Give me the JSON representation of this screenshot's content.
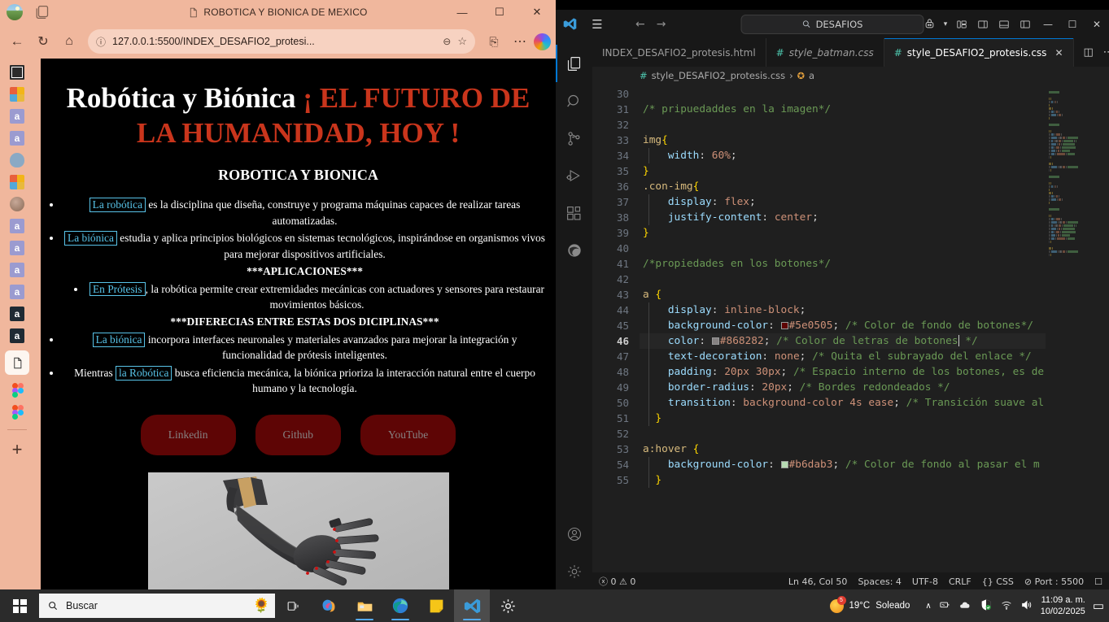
{
  "browser": {
    "window_title": "ROBOTICA Y BIONICA DE MEXICO",
    "url": "127.0.0.1:5500/INDEX_DESAFIO2_protesi...",
    "minimize": "—",
    "maximize": "☐",
    "close": "✕",
    "back_icon": "←",
    "refresh_icon": "↻",
    "home_icon": "⌂",
    "info_icon": "ⓘ",
    "zoom_icon": "⊖",
    "favorite_icon": "☆",
    "collections_icon": "⎘",
    "more_icon": "⋯",
    "sidebar_plus": "+"
  },
  "page": {
    "title_white": "Robótica y Biónica",
    "title_red": "¡ EL FUTURO DE LA HUMANIDAD, HOY !",
    "subtitle": "ROBOTICA Y BIONICA",
    "items": [
      {
        "tag": "La robótica",
        "text": " es la disciplina que diseña, construye y programa máquinas capaces de realizar tareas automatizadas."
      },
      {
        "tag": "La biónica",
        "text": " estudia y aplica principios biológicos en sistemas tecnológicos, inspirándose en organismos vivos para mejorar dispositivos artificiales."
      }
    ],
    "section_aplicaciones": "***APLICACIONES***",
    "item_protesis_tag": "En Prótesis",
    "item_protesis_text": ", la robótica permite crear extremidades mecánicas con actuadores y sensores para restaurar movimientos básicos.",
    "section_diferencias": "***DIFERECIAS ENTRE ESTAS DOS DICIPLINAS***",
    "items2": [
      {
        "pre": "",
        "tag": "La biónica",
        "text": " incorpora interfaces neuronales y materiales avanzados para mejorar la integración y funcionalidad de prótesis inteligentes."
      },
      {
        "pre": "Mientras ",
        "tag": "la Robótica",
        "text": " busca eficiencia mecánica, la biónica prioriza la interacción natural entre el cuerpo humano y la tecnología."
      }
    ],
    "buttons": [
      "Linkedin",
      "Github",
      "YouTube"
    ],
    "colors": {
      "button_bg": "#5e0505",
      "button_text": "#868282",
      "tag_color": "#58c3e8",
      "heading_red": "#c9351c",
      "page_bg": "#000000"
    }
  },
  "vscode": {
    "search_placeholder": "DESAFIOS",
    "search_icon": "⌕",
    "hamburger_icon": "☰",
    "back_icon": "←",
    "forward_icon": "→",
    "accounts_icon": "☉",
    "layout_icons": [
      "⌸",
      "◫",
      "▥",
      "◫"
    ],
    "minimize": "—",
    "maximize": "☐",
    "close": "✕",
    "tabs": [
      {
        "label": "INDEX_DESAFIO2_protesis.html",
        "hash": "",
        "active": false,
        "italic": false
      },
      {
        "label": "style_batman.css",
        "hash": "#",
        "active": false,
        "italic": true
      },
      {
        "label": "style_DESAFIO2_protesis.css",
        "hash": "#",
        "active": true,
        "italic": false
      }
    ],
    "tab_close": "✕",
    "split_icon": "◫",
    "more_icon": "⋯",
    "breadcrumb": {
      "hash": "#",
      "file": "style_DESAFIO2_protesis.css",
      "sep": "›",
      "symbol": "a"
    },
    "line_start": 30,
    "lines": [
      {
        "n": 30,
        "tokens": []
      },
      {
        "n": 31,
        "tokens": [
          {
            "t": "comment",
            "v": "/* pripuedaddes en la imagen*/"
          }
        ]
      },
      {
        "n": 32,
        "tokens": []
      },
      {
        "n": 33,
        "tokens": [
          {
            "t": "selector",
            "v": "img"
          },
          {
            "t": "brace",
            "v": "{"
          }
        ]
      },
      {
        "n": 34,
        "tokens": [
          {
            "t": "plain",
            "v": "    "
          },
          {
            "t": "prop",
            "v": "width"
          },
          {
            "t": "punct",
            "v": ": "
          },
          {
            "t": "val",
            "v": "60%"
          },
          {
            "t": "punct",
            "v": ";"
          }
        ]
      },
      {
        "n": 35,
        "tokens": [
          {
            "t": "brace",
            "v": "}"
          }
        ]
      },
      {
        "n": 36,
        "tokens": [
          {
            "t": "selector",
            "v": ".con-img"
          },
          {
            "t": "brace",
            "v": "{"
          }
        ]
      },
      {
        "n": 37,
        "tokens": [
          {
            "t": "plain",
            "v": "    "
          },
          {
            "t": "prop",
            "v": "display"
          },
          {
            "t": "punct",
            "v": ": "
          },
          {
            "t": "val",
            "v": "flex"
          },
          {
            "t": "punct",
            "v": ";"
          }
        ]
      },
      {
        "n": 38,
        "tokens": [
          {
            "t": "plain",
            "v": "    "
          },
          {
            "t": "prop",
            "v": "justify-content"
          },
          {
            "t": "punct",
            "v": ": "
          },
          {
            "t": "val",
            "v": "center"
          },
          {
            "t": "punct",
            "v": ";"
          }
        ]
      },
      {
        "n": 39,
        "tokens": [
          {
            "t": "brace",
            "v": "}"
          }
        ]
      },
      {
        "n": 40,
        "tokens": []
      },
      {
        "n": 41,
        "tokens": [
          {
            "t": "comment",
            "v": "/*propiedades en los botones*/"
          }
        ]
      },
      {
        "n": 42,
        "tokens": []
      },
      {
        "n": 43,
        "tokens": [
          {
            "t": "selector",
            "v": "a "
          },
          {
            "t": "brace",
            "v": "{"
          }
        ]
      },
      {
        "n": 44,
        "tokens": [
          {
            "t": "plain",
            "v": "    "
          },
          {
            "t": "prop",
            "v": "display"
          },
          {
            "t": "punct",
            "v": ": "
          },
          {
            "t": "val",
            "v": "inline-block"
          },
          {
            "t": "punct",
            "v": ";"
          }
        ]
      },
      {
        "n": 45,
        "tokens": [
          {
            "t": "plain",
            "v": "    "
          },
          {
            "t": "prop",
            "v": "background-color"
          },
          {
            "t": "punct",
            "v": ": "
          },
          {
            "t": "swatch",
            "v": "#5e0505"
          },
          {
            "t": "val",
            "v": "#5e0505"
          },
          {
            "t": "punct",
            "v": "; "
          },
          {
            "t": "comment",
            "v": "/* Color de fondo de botones*/"
          }
        ]
      },
      {
        "n": 46,
        "tokens": [
          {
            "t": "plain",
            "v": "    "
          },
          {
            "t": "prop",
            "v": "color"
          },
          {
            "t": "punct",
            "v": ": "
          },
          {
            "t": "swatch",
            "v": "#868282"
          },
          {
            "t": "val",
            "v": "#868282"
          },
          {
            "t": "punct",
            "v": "; "
          },
          {
            "t": "comment",
            "v": "/* Color de letras de botones"
          },
          {
            "t": "caret",
            "v": ""
          },
          {
            "t": "comment",
            "v": " */"
          }
        ]
      },
      {
        "n": 47,
        "tokens": [
          {
            "t": "plain",
            "v": "    "
          },
          {
            "t": "prop",
            "v": "text-decoration"
          },
          {
            "t": "punct",
            "v": ": "
          },
          {
            "t": "val",
            "v": "none"
          },
          {
            "t": "punct",
            "v": "; "
          },
          {
            "t": "comment",
            "v": "/* Quita el subrayado del enlace */"
          }
        ]
      },
      {
        "n": 48,
        "tokens": [
          {
            "t": "plain",
            "v": "    "
          },
          {
            "t": "prop",
            "v": "padding"
          },
          {
            "t": "punct",
            "v": ": "
          },
          {
            "t": "val",
            "v": "20px 30px"
          },
          {
            "t": "punct",
            "v": "; "
          },
          {
            "t": "comment",
            "v": "/* Espacio interno de los botones, es de"
          }
        ]
      },
      {
        "n": 49,
        "tokens": [
          {
            "t": "plain",
            "v": "    "
          },
          {
            "t": "prop",
            "v": "border-radius"
          },
          {
            "t": "punct",
            "v": ": "
          },
          {
            "t": "val",
            "v": "20px"
          },
          {
            "t": "punct",
            "v": "; "
          },
          {
            "t": "comment",
            "v": "/* Bordes redondeados */"
          }
        ]
      },
      {
        "n": 50,
        "tokens": [
          {
            "t": "plain",
            "v": "    "
          },
          {
            "t": "prop",
            "v": "transition"
          },
          {
            "t": "punct",
            "v": ": "
          },
          {
            "t": "val",
            "v": "background-color 4s ease"
          },
          {
            "t": "punct",
            "v": "; "
          },
          {
            "t": "comment",
            "v": "/* Transición suave al"
          }
        ]
      },
      {
        "n": 51,
        "tokens": [
          {
            "t": "plain",
            "v": "  "
          },
          {
            "t": "brace",
            "v": "}"
          }
        ]
      },
      {
        "n": 52,
        "tokens": []
      },
      {
        "n": 53,
        "tokens": [
          {
            "t": "selector",
            "v": "a:hover "
          },
          {
            "t": "brace",
            "v": "{"
          }
        ]
      },
      {
        "n": 54,
        "tokens": [
          {
            "t": "plain",
            "v": "    "
          },
          {
            "t": "prop",
            "v": "background-color"
          },
          {
            "t": "punct",
            "v": ": "
          },
          {
            "t": "swatch",
            "v": "#b6dab3"
          },
          {
            "t": "val",
            "v": "#b6dab3"
          },
          {
            "t": "punct",
            "v": "; "
          },
          {
            "t": "comment",
            "v": "/* Color de fondo al pasar el m"
          }
        ]
      },
      {
        "n": 55,
        "tokens": [
          {
            "t": "plain",
            "v": "  "
          },
          {
            "t": "brace",
            "v": "}"
          }
        ]
      }
    ],
    "cursor_line": 46,
    "status": {
      "errors_icon": "ⓧ",
      "errors": "0",
      "warnings_icon": "⚠",
      "warnings": "0",
      "position": "Ln 46, Col 50",
      "spaces": "Spaces: 4",
      "encoding": "UTF-8",
      "eol": "CRLF",
      "language_icon": "{}",
      "language": "CSS",
      "port": "Port : 5500",
      "port_icon": "⊘",
      "bell_icon": "☐"
    },
    "activity_icons": [
      "explorer-icon",
      "search-icon",
      "source-control-icon",
      "run-debug-icon",
      "extensions-icon",
      "edge-tools-icon"
    ],
    "bottom_icons": [
      "accounts-icon",
      "settings-gear-icon"
    ]
  },
  "taskbar": {
    "search_text": "Buscar",
    "search_icon": "⌕",
    "apps": [
      "task-view",
      "copilot",
      "file-explorer",
      "edge",
      "sticky-notes",
      "vscode",
      "settings"
    ],
    "weather_temp": "19°C",
    "weather_desc": "Soleado",
    "weather_badge": "5",
    "chevron": "∧",
    "time": "11:09 a. m.",
    "date": "10/02/2025",
    "notification_icon": "▭"
  }
}
